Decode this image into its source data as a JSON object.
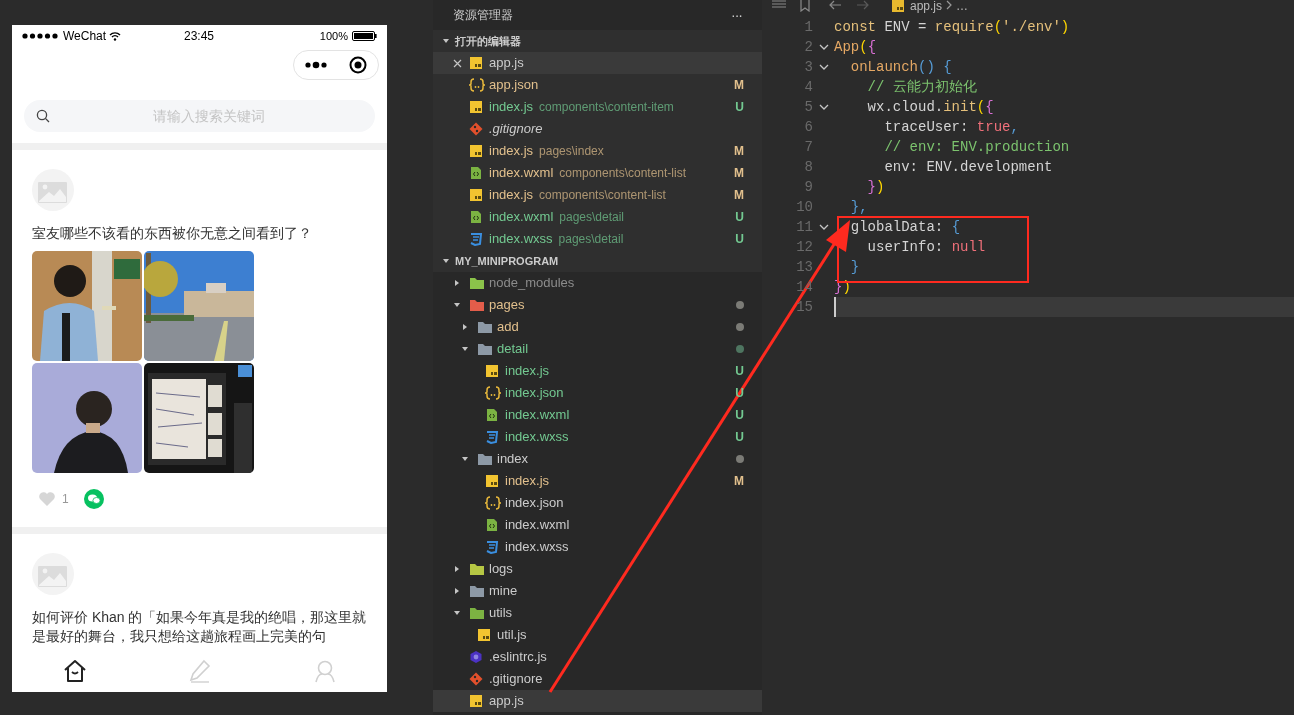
{
  "phone": {
    "status_bar": {
      "carrier": "WeChat",
      "time": "23:45",
      "battery": "100%"
    },
    "search": {
      "placeholder": "请输入搜索关键词"
    },
    "posts": [
      {
        "title": "室友哪些不该看的东西被你无意之间看到了？",
        "likes": "1"
      },
      {
        "title": "如何评价 Khan 的「如果今年真是我的绝唱，那这里就是最好的舞台，我只想给这趟旅程画上完美的句"
      }
    ],
    "tabbar": [
      {
        "kind": "home",
        "selected": true
      },
      {
        "kind": "edit",
        "selected": false
      },
      {
        "kind": "profile",
        "selected": false
      }
    ]
  },
  "explorer": {
    "title": "资源管理器",
    "more": "···",
    "open_editors": {
      "title": "打开的编辑器",
      "expanded": true,
      "items": [
        {
          "name": "app.js",
          "kind": "js",
          "selected": true,
          "preview": false
        },
        {
          "name": "app.json",
          "kind": "json",
          "color": "#e2c08d",
          "badge": "M",
          "selected": false,
          "preview": false
        },
        {
          "name": "index.js",
          "path": "components\\content-item",
          "kind": "js",
          "color": "#73c991",
          "badge": "U",
          "selected": false,
          "preview": false
        },
        {
          "name": ".gitignore",
          "kind": "git",
          "selected": false,
          "preview": true
        },
        {
          "name": "index.js",
          "path": "pages\\index",
          "kind": "js",
          "color": "#e2c08d",
          "badge": "M",
          "selected": false,
          "preview": false
        },
        {
          "name": "index.wxml",
          "path": "components\\content-list",
          "kind": "wxml",
          "color": "#e2c08d",
          "badge": "M",
          "selected": false,
          "preview": false
        },
        {
          "name": "index.js",
          "path": "components\\content-list",
          "kind": "js",
          "color": "#e2c08d",
          "badge": "M",
          "selected": false,
          "preview": false
        },
        {
          "name": "index.wxml",
          "path": "pages\\detail",
          "kind": "wxml",
          "color": "#73c991",
          "badge": "U",
          "selected": false,
          "preview": false
        },
        {
          "name": "index.wxss",
          "path": "pages\\detail",
          "kind": "wxss",
          "color": "#73c991",
          "badge": "U",
          "selected": false,
          "preview": false
        }
      ]
    },
    "tree": {
      "title": "MY_MINIPROGRAM",
      "expanded": true,
      "items": [
        {
          "name": "node_modules",
          "kind": "folder-node",
          "expanded": false,
          "color": "#8c8c8c",
          "selected": false
        },
        {
          "name": "pages",
          "kind": "folder-pages",
          "expanded": true,
          "color": "#e2c08d",
          "dot": {
            "color": "#7b7b76"
          },
          "selected": false,
          "children": [
            {
              "name": "add",
              "kind": "folder",
              "expanded": false,
              "color": "#e2c08d",
              "dot": {
                "color": "#7b7b76"
              },
              "selected": false
            },
            {
              "name": "detail",
              "kind": "folder",
              "expanded": true,
              "color": "#73c991",
              "dot": {
                "color": "#4e7560"
              },
              "selected": false,
              "children": [
                {
                  "name": "index.js",
                  "kind": "js",
                  "color": "#73c991",
                  "badge": "U",
                  "selected": false
                },
                {
                  "name": "index.json",
                  "kind": "json",
                  "color": "#73c991",
                  "badge": "U",
                  "selected": false
                },
                {
                  "name": "index.wxml",
                  "kind": "wxml",
                  "color": "#73c991",
                  "badge": "U",
                  "selected": false
                },
                {
                  "name": "index.wxss",
                  "kind": "wxss",
                  "color": "#73c991",
                  "badge": "U",
                  "selected": false
                }
              ]
            },
            {
              "name": "index",
              "kind": "folder",
              "expanded": true,
              "dot": {
                "color": "#7b7b76"
              },
              "selected": false,
              "children": [
                {
                  "name": "index.js",
                  "kind": "js",
                  "color": "#e2c08d",
                  "badge": "M",
                  "selected": false
                },
                {
                  "name": "index.json",
                  "kind": "json",
                  "selected": false
                },
                {
                  "name": "index.wxml",
                  "kind": "wxml",
                  "selected": false
                },
                {
                  "name": "index.wxss",
                  "kind": "wxss",
                  "selected": false
                }
              ]
            }
          ]
        },
        {
          "name": "logs",
          "kind": "folder-logs",
          "expanded": false,
          "selected": false
        },
        {
          "name": "mine",
          "kind": "folder",
          "expanded": false,
          "selected": false
        },
        {
          "name": "utils",
          "kind": "folder-utils",
          "expanded": true,
          "selected": false,
          "children": [
            {
              "name": "util.js",
              "kind": "js",
              "selected": false
            }
          ]
        },
        {
          "name": ".eslintrc.js",
          "kind": "eslint",
          "selected": false
        },
        {
          "name": ".gitignore",
          "kind": "git",
          "selected": false
        },
        {
          "name": "app.js",
          "kind": "js",
          "selected": true
        }
      ]
    }
  },
  "editor": {
    "breadcrumb": {
      "file": "app.js",
      "more": "…"
    },
    "lines": [
      {
        "number": "1",
        "foldable": false,
        "current": false,
        "tokens": [
          {
            "text": "const",
            "kind": "keyword"
          },
          {
            "text": " ENV = ",
            "kind": "plain"
          },
          {
            "text": "require",
            "kind": "func"
          },
          {
            "text": "(",
            "kind": "paren1"
          },
          {
            "text": "'./env'",
            "kind": "string"
          },
          {
            "text": ")",
            "kind": "paren1"
          }
        ]
      },
      {
        "number": "2",
        "foldable": true,
        "current": false,
        "tokens": [
          {
            "text": "App",
            "kind": "method"
          },
          {
            "text": "(",
            "kind": "paren1"
          },
          {
            "text": "{",
            "kind": "paren2"
          }
        ]
      },
      {
        "number": "3",
        "foldable": true,
        "current": false,
        "tokens": [
          {
            "text": "  onLaunch",
            "kind": "method"
          },
          {
            "text": "() {",
            "kind": "paren3"
          }
        ]
      },
      {
        "number": "4",
        "foldable": false,
        "current": false,
        "tokens": [
          {
            "text": "    // 云能力初始化",
            "kind": "comment"
          }
        ]
      },
      {
        "number": "5",
        "foldable": true,
        "current": false,
        "tokens": [
          {
            "text": "    wx.cloud.",
            "kind": "plain"
          },
          {
            "text": "init",
            "kind": "func"
          },
          {
            "text": "(",
            "kind": "paren1"
          },
          {
            "text": "{",
            "kind": "paren2"
          }
        ]
      },
      {
        "number": "6",
        "foldable": false,
        "current": false,
        "tokens": [
          {
            "text": "      traceUser: ",
            "kind": "plain"
          },
          {
            "text": "true",
            "kind": "literal"
          },
          {
            "text": ",",
            "kind": "paren3"
          }
        ]
      },
      {
        "number": "7",
        "foldable": false,
        "current": false,
        "tokens": [
          {
            "text": "      // env: ENV.production",
            "kind": "comment"
          }
        ]
      },
      {
        "number": "8",
        "foldable": false,
        "current": false,
        "tokens": [
          {
            "text": "      env: ENV.development",
            "kind": "plain"
          }
        ]
      },
      {
        "number": "9",
        "foldable": false,
        "current": false,
        "tokens": [
          {
            "text": "    }",
            "kind": "paren2"
          },
          {
            "text": ")",
            "kind": "paren1"
          }
        ]
      },
      {
        "number": "10",
        "foldable": false,
        "current": false,
        "tokens": [
          {
            "text": "  },",
            "kind": "paren3"
          }
        ]
      },
      {
        "number": "11",
        "foldable": true,
        "current": false,
        "tokens": [
          {
            "text": "  globalData: ",
            "kind": "plain"
          },
          {
            "text": "{",
            "kind": "paren3"
          }
        ]
      },
      {
        "number": "12",
        "foldable": false,
        "current": false,
        "tokens": [
          {
            "text": "    userInfo: ",
            "kind": "plain"
          },
          {
            "text": "null",
            "kind": "literal"
          }
        ]
      },
      {
        "number": "13",
        "foldable": false,
        "current": false,
        "tokens": [
          {
            "text": "  }",
            "kind": "paren3"
          }
        ]
      },
      {
        "number": "14",
        "foldable": false,
        "current": false,
        "tokens": [
          {
            "text": "}",
            "kind": "paren2"
          },
          {
            "text": ")",
            "kind": "paren1"
          }
        ]
      },
      {
        "number": "15",
        "foldable": false,
        "current": true
      }
    ]
  }
}
